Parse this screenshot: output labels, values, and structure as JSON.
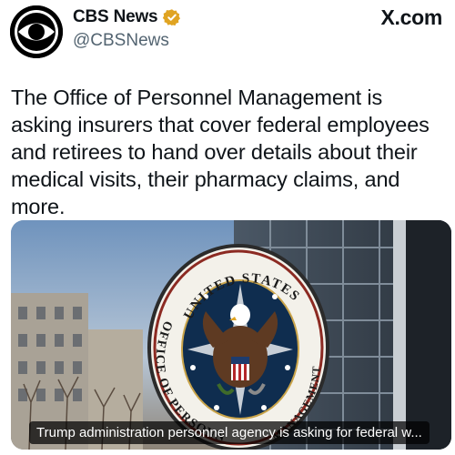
{
  "post": {
    "author": {
      "display_name": "CBS News",
      "handle": "@CBSNews",
      "verified": true,
      "avatar_icon": "cbs-eye-logo-icon"
    },
    "source_label": "X.com",
    "text": "The Office of Personnel Management is asking insurers that cover federal employees and retirees to hand over details about their medical visits, their pharmacy claims, and more.",
    "media": {
      "seal_text": "UNITED STATES OFFICE OF PERSONNEL MANAGEMENT",
      "caption": "Trump administration personnel agency is asking for federal w..."
    }
  },
  "colors": {
    "text": "#0f1419",
    "secondary_text": "#536471",
    "verified_badge": "#e0a422",
    "caption_bg": "#000000"
  }
}
